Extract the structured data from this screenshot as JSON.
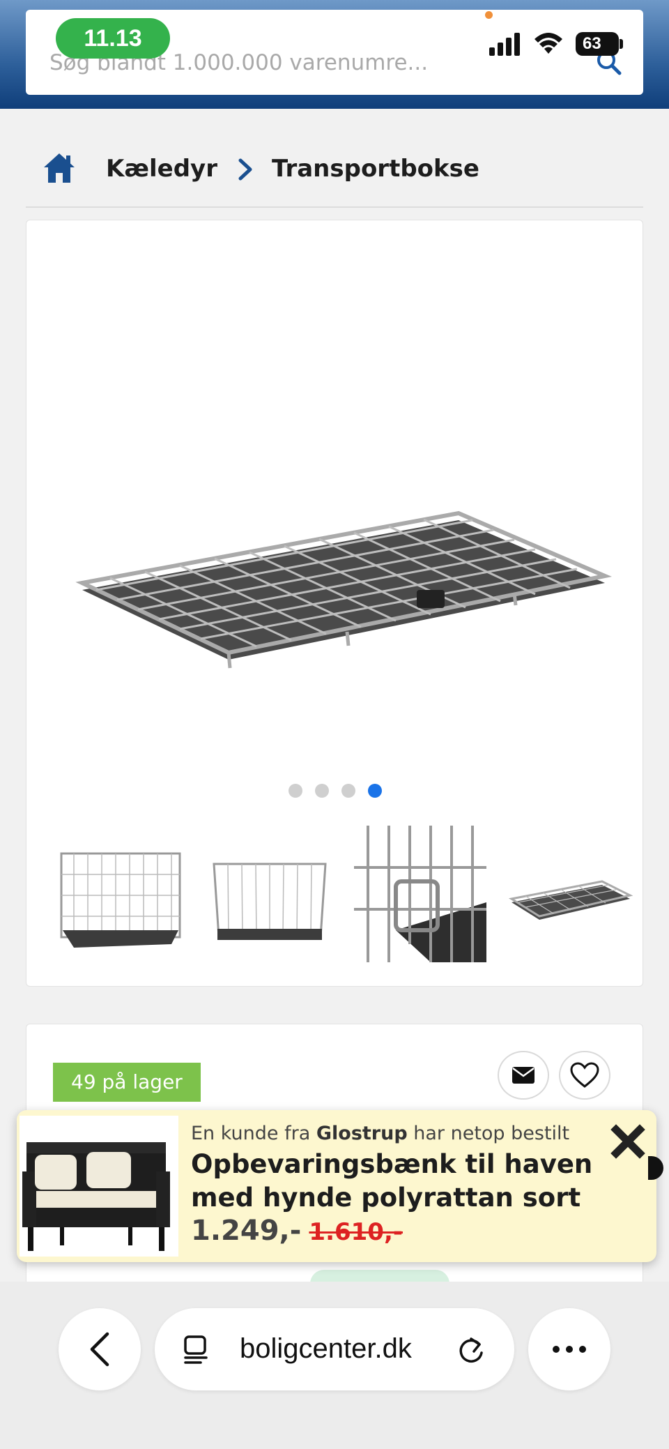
{
  "status_bar": {
    "time": "11.13",
    "battery": "63"
  },
  "search": {
    "placeholder": "Søg blandt 1.000.000 varenumre..."
  },
  "breadcrumb": {
    "items": [
      "Kæledyr",
      "Transportbokse"
    ]
  },
  "gallery": {
    "dot_count": 4,
    "active_index": 3,
    "thumbnail_count": 4
  },
  "product": {
    "stock_label": "49 på lager"
  },
  "notification": {
    "prefix": "En kunde fra ",
    "city": "Glostrup",
    "suffix": " har netop bestilt",
    "title": "Opbevaringsbænk til haven med hynde polyrattan sort",
    "price": "1.249,-",
    "old_price": "1.610,-"
  },
  "browser": {
    "url": "boligcenter.dk"
  },
  "colors": {
    "header_blue": "#0f3e7a",
    "stock_green": "#7dc24b",
    "active_dot": "#1a73e8",
    "time_pill": "#34b24c",
    "old_price_red": "#dd2222",
    "notification_bg": "#fdf7cf"
  }
}
